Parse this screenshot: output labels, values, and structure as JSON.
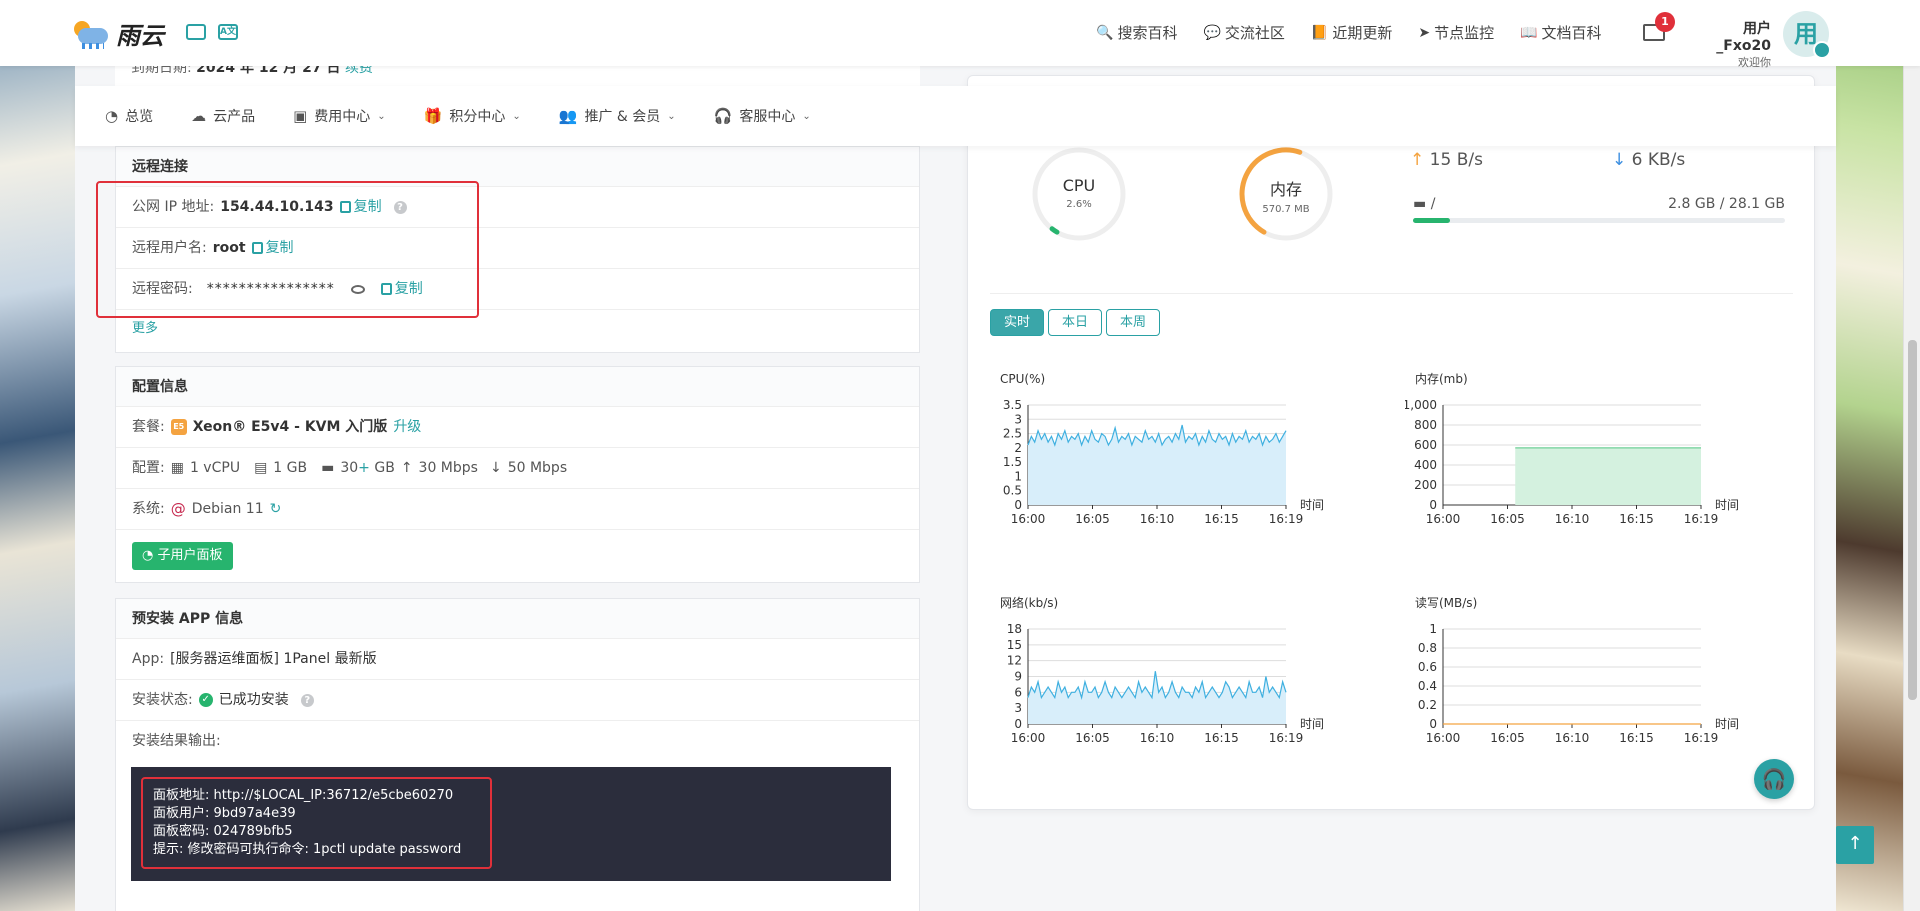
{
  "header": {
    "logo_text": "雨云",
    "icon_names": [
      "image-icon",
      "translate-icon"
    ],
    "translate_icon_text": "A文",
    "nav": [
      {
        "icon": "search-icon",
        "glyph": "🔍",
        "label": "搜索百科"
      },
      {
        "icon": "community-icon",
        "glyph": "💬",
        "label": "交流社区"
      },
      {
        "icon": "updates-icon",
        "glyph": "📙",
        "label": "近期更新"
      },
      {
        "icon": "monitor-icon",
        "glyph": "➤",
        "label": "节点监控"
      },
      {
        "icon": "docs-icon",
        "glyph": "📖",
        "label": "文档百科"
      }
    ],
    "mail_badge": "1",
    "user_name": "用户_Fxo20",
    "user_greeting": "欢迎你",
    "avatar_char": "用"
  },
  "subnav": [
    {
      "icon": "dashboard-icon",
      "glyph": "◔",
      "label": "总览",
      "dropdown": false
    },
    {
      "icon": "cloud-icon",
      "glyph": "☁",
      "label": "云产品",
      "dropdown": false
    },
    {
      "icon": "billing-icon",
      "glyph": "▣",
      "label": "费用中心",
      "dropdown": true
    },
    {
      "icon": "gift-icon",
      "glyph": "🎁",
      "label": "积分中心",
      "dropdown": true
    },
    {
      "icon": "users-icon",
      "glyph": "👥",
      "label": "推广 & 会员",
      "dropdown": true
    },
    {
      "icon": "headset-icon",
      "glyph": "🎧",
      "label": "客服中心",
      "dropdown": true
    }
  ],
  "expiry": {
    "label": "到期日期:",
    "value": "2024 年 12 月 27 日",
    "renew": "续费"
  },
  "remote": {
    "title": "远程连接",
    "ip_label": "公网 IP 地址:",
    "ip_value": "154.44.10.143",
    "user_label": "远程用户名:",
    "user_value": "root",
    "pwd_label": "远程密码:",
    "pwd_value": "****************",
    "copy_label": "复制",
    "help_glyph": "?",
    "more": "更多"
  },
  "config": {
    "title": "配置信息",
    "plan_label": "套餐:",
    "plan_chip": "E5",
    "plan_value": "Xeon® E5v4 - KVM 入门版",
    "upgrade": "升级",
    "spec_label": "配置:",
    "cpu": "1 vCPU",
    "ram": "1 GB",
    "disk": "30",
    "disk_plus": "+",
    "disk_unit": "GB",
    "up_bw": "30 Mbps",
    "down_bw": "50 Mbps",
    "os_label": "系统:",
    "os_value": "Debian 11",
    "subuser_button": "子用户面板"
  },
  "preinstall": {
    "title": "预安装 APP 信息",
    "app_label": "App:",
    "app_value": "[服务器运维面板] 1Panel 最新版",
    "status_label": "安装状态:",
    "status_value": "已成功安装",
    "output_label": "安装结果输出:",
    "output_lines": [
      "面板地址: http://$LOCAL_IP:36712/e5cbe60270",
      "面板用户: 9bd97a4e39",
      "面板密码: 024789bfb5",
      "提示: 修改密码可执行命令: 1pctl update password"
    ]
  },
  "monitor": {
    "cpu_label": "CPU",
    "cpu_value": "2.6%",
    "cpu_fraction": 0.026,
    "mem_label": "内存",
    "mem_value": "570.7 MB",
    "mem_fraction": 0.56,
    "upload": "15 B/s",
    "download": "6 KB/s",
    "disk_mount": "/",
    "disk_usage": "2.8 GB / 28.1 GB",
    "disk_fraction": 0.1,
    "tabs": [
      "实时",
      "本日",
      "本周"
    ],
    "active_tab": 0
  },
  "colors": {
    "accent": "#2aa1a4",
    "success": "#27b46e",
    "danger": "#e0303a",
    "warning": "#f4a340"
  },
  "chart_data": [
    {
      "type": "area",
      "title": "CPU(%)",
      "xlabel": "时间",
      "x_ticks": [
        "16:00",
        "16:05",
        "16:10",
        "16:15",
        "16:19"
      ],
      "y_ticks": [
        "0",
        "0.5",
        "1",
        "1.5",
        "2",
        "2.5",
        "3",
        "3.5"
      ],
      "ylim": [
        0,
        3.5
      ],
      "color": "#3fb0e0",
      "fill": "#d8eefa",
      "values": [
        2.1,
        2.4,
        2.2,
        2.6,
        2.3,
        2.5,
        2.2,
        2.4,
        2.1,
        2.5,
        2.3,
        2.6,
        2.2,
        2.4,
        2.3,
        2.5,
        2.1,
        2.4,
        2.2,
        2.6,
        2.3,
        2.2,
        2.5,
        2.4,
        2.1,
        2.3,
        2.7,
        2.2,
        2.4,
        2.3,
        2.5,
        2.1,
        2.4,
        2.3,
        2.2,
        2.6,
        2.3,
        2.4,
        2.2,
        2.5,
        2.1,
        2.3,
        2.4,
        2.2,
        2.5,
        2.3,
        2.8,
        2.2,
        2.4,
        2.3,
        2.5,
        2.1,
        2.4,
        2.2,
        2.6,
        2.3,
        2.2,
        2.5,
        2.3,
        2.4,
        2.1,
        2.5,
        2.2,
        2.4,
        2.3,
        2.6,
        2.2,
        2.4,
        2.3,
        2.5,
        2.1,
        2.4,
        2.2,
        2.3,
        2.5,
        2.2,
        2.4,
        2.6
      ]
    },
    {
      "type": "area",
      "title": "内存(mb)",
      "xlabel": "时间",
      "x_ticks": [
        "16:00",
        "16:05",
        "16:10",
        "16:15",
        "16:19"
      ],
      "y_ticks": [
        "0",
        "200",
        "400",
        "600",
        "800",
        "1,000"
      ],
      "ylim": [
        0,
        1000
      ],
      "color": "#6fcf97",
      "fill": "#d4f1df",
      "start_fraction": 0.28,
      "values": [
        571,
        571,
        571,
        571,
        571,
        571,
        571,
        571,
        571,
        571,
        571,
        571,
        571,
        571,
        571,
        571,
        571,
        571,
        571,
        571
      ]
    },
    {
      "type": "area",
      "title": "网络(kb/s)",
      "xlabel": "时间",
      "x_ticks": [
        "16:00",
        "16:05",
        "16:10",
        "16:15",
        "16:19"
      ],
      "y_ticks": [
        "0",
        "3",
        "6",
        "9",
        "12",
        "15",
        "18"
      ],
      "ylim": [
        0,
        18
      ],
      "color": "#3fb0e0",
      "fill": "#d8eefa",
      "values": [
        5,
        7,
        6,
        8,
        5,
        6,
        7,
        6,
        5,
        8,
        6,
        7,
        5,
        6,
        6,
        7,
        5,
        8,
        6,
        6,
        7,
        5,
        6,
        8,
        6,
        5,
        7,
        6,
        5,
        6,
        7,
        6,
        5,
        8,
        6,
        7,
        6,
        5,
        10,
        6,
        7,
        5,
        6,
        8,
        6,
        5,
        7,
        6,
        6,
        5,
        7,
        6,
        8,
        5,
        6,
        7,
        6,
        5,
        6,
        8,
        7,
        5,
        6,
        7,
        6,
        5,
        8,
        6,
        6,
        7,
        5,
        9,
        6,
        7,
        6,
        5,
        8,
        6
      ]
    },
    {
      "type": "line",
      "title": "读写(MB/s)",
      "xlabel": "时间",
      "x_ticks": [
        "16:00",
        "16:05",
        "16:10",
        "16:15",
        "16:19"
      ],
      "y_ticks": [
        "0",
        "0.2",
        "0.4",
        "0.6",
        "0.8",
        "1"
      ],
      "ylim": [
        0,
        1
      ],
      "color": "#f4a340",
      "fill": "none",
      "values": [
        0,
        0,
        0,
        0,
        0,
        0,
        0,
        0,
        0,
        0,
        0,
        0,
        0,
        0,
        0,
        0,
        0,
        0,
        0,
        0
      ]
    }
  ]
}
